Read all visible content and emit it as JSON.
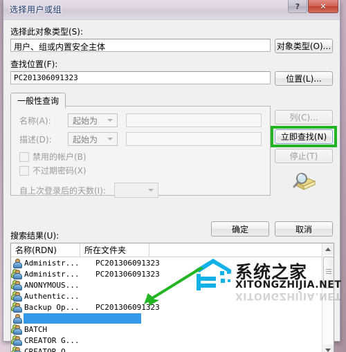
{
  "window": {
    "title": "选择用户或组",
    "help_button": "?",
    "close_button": "✕"
  },
  "object_type": {
    "label": "选择此对象类型(S):",
    "value": "用户、组或内置安全主体",
    "button": "对象类型(O)..."
  },
  "location": {
    "label": "查找位置(F):",
    "value": "PC201306091323",
    "button": "位置(L)..."
  },
  "tab": {
    "label": "一般性查询"
  },
  "query": {
    "name_label": "名称(A):",
    "name_condition": "起始为",
    "name_value": "",
    "desc_label": "描述(D):",
    "desc_condition": "起始为",
    "desc_value": "",
    "disabled_accounts": "禁用的帐户(B)",
    "non_expiring_password": "不过期密码(X)",
    "days_since_login_label": "自上次登录后的天数(I):",
    "days_since_login_value": ""
  },
  "side_buttons": {
    "columns": "列(C)...",
    "find_now": "立即查找(N)",
    "stop": "停止(T)"
  },
  "dialog_buttons": {
    "ok": "确定",
    "cancel": "取消"
  },
  "results": {
    "label": "搜索结果(U):",
    "columns": [
      "名称(RDN)",
      "所在文件夹",
      ""
    ],
    "rows": [
      {
        "icon": "user-icon",
        "name": "Administr...",
        "folder": "PC201306091323",
        "selected": false
      },
      {
        "icon": "group-icon",
        "name": "Administr...",
        "folder": "PC201306091323",
        "selected": false
      },
      {
        "icon": "group-icon",
        "name": "ANONYMOUS...",
        "folder": "",
        "selected": false
      },
      {
        "icon": "group-icon",
        "name": "Authentic...",
        "folder": "",
        "selected": false
      },
      {
        "icon": "group-icon",
        "name": "Backup Op...",
        "folder": "PC201306091323",
        "selected": false
      },
      {
        "icon": "user-icon",
        "name": "",
        "folder": "",
        "selected": true
      },
      {
        "icon": "group-icon",
        "name": "BATCH",
        "folder": "",
        "selected": false
      },
      {
        "icon": "group-icon",
        "name": "CREATOR G...",
        "folder": "",
        "selected": false
      },
      {
        "icon": "group-icon",
        "name": "CREATOR O...",
        "folder": "",
        "selected": false
      }
    ]
  },
  "watermark": {
    "text": "系统之家",
    "subtext": "XITONGZHIJIA.NET"
  },
  "colors": {
    "highlight_box": "#22b422",
    "arrow": "#22b422",
    "selection": "#3399e8",
    "title_text": "#18376b",
    "close_button": "#bf4234"
  }
}
